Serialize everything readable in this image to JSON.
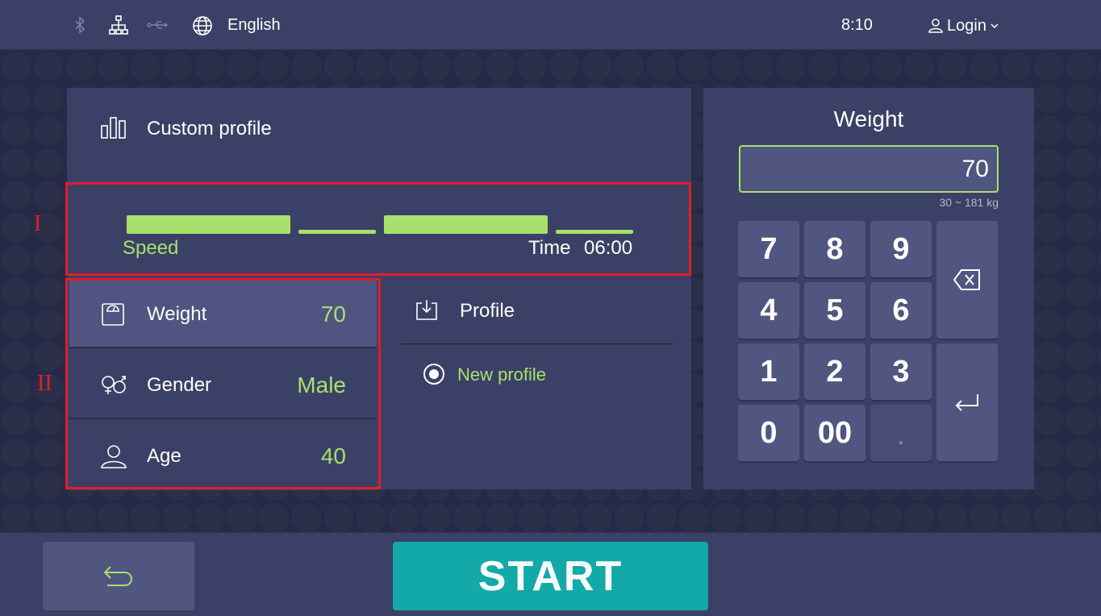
{
  "topbar": {
    "icons": [
      "bluetooth-icon",
      "network-icon",
      "usb-icon",
      "globe-icon"
    ],
    "language": "English",
    "time": "8:10",
    "login_label": "Login"
  },
  "profile_panel": {
    "title": "Custom profile",
    "annotation_1": "I",
    "annotation_2": "II",
    "speed_label": "Speed",
    "time_label": "Time",
    "time_value": "06:00"
  },
  "settings": {
    "weight_label": "Weight",
    "weight_value": "70",
    "gender_label": "Gender",
    "gender_value": "Male",
    "age_label": "Age",
    "age_value": "40"
  },
  "profile_select": {
    "header": "Profile",
    "option": "New profile"
  },
  "keypad": {
    "title": "Weight",
    "value": "70",
    "range": "30 ~ 181 kg",
    "keys": [
      "7",
      "8",
      "9",
      "4",
      "5",
      "6",
      "1",
      "2",
      "3",
      "0",
      "00",
      "."
    ]
  },
  "footer": {
    "start_label": "START"
  },
  "colors": {
    "accent_green": "#a8e06c",
    "start_teal": "#12a9a8",
    "annotation_red": "#e11d2a"
  }
}
